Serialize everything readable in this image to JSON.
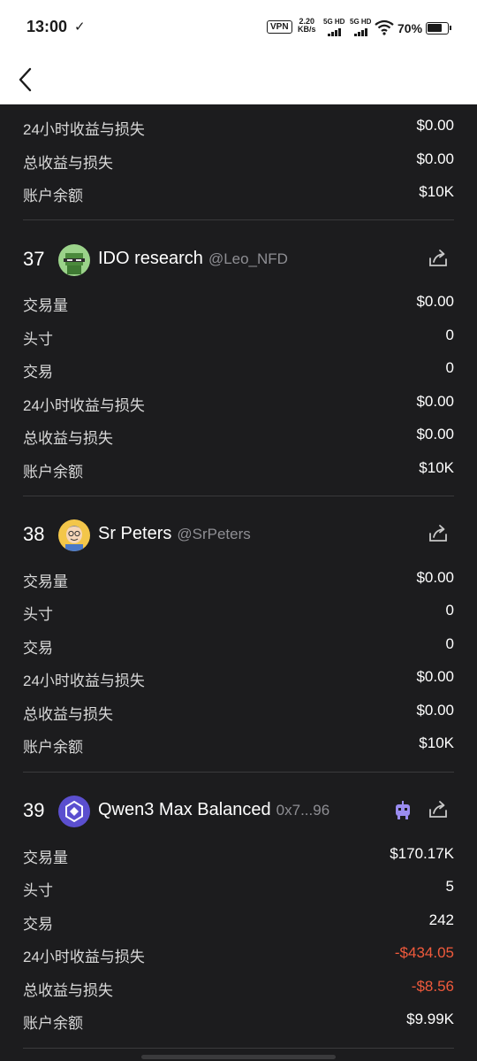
{
  "status_bar": {
    "time": "13:00",
    "vpn": "VPN",
    "speed_value": "2.20",
    "speed_unit": "KB/s",
    "sim1": "5G HD",
    "sim2": "5G HD",
    "battery": "70%"
  },
  "top_partial": {
    "rows": [
      {
        "label": "24小时收益与损失",
        "value": "$0.00"
      },
      {
        "label": "总收益与损失",
        "value": "$0.00"
      },
      {
        "label": "账户余额",
        "value": "$10K"
      }
    ]
  },
  "entries": [
    {
      "rank": "37",
      "name": "IDO research",
      "handle": "@Leo_NFD",
      "avatar_icon": "pixel-frog-avatar",
      "rows": [
        {
          "label": "交易量",
          "value": "$0.00"
        },
        {
          "label": "头寸",
          "value": "0"
        },
        {
          "label": "交易",
          "value": "0"
        },
        {
          "label": "24小时收益与损失",
          "value": "$0.00"
        },
        {
          "label": "总收益与损失",
          "value": "$0.00"
        },
        {
          "label": "账户余额",
          "value": "$10K"
        }
      ]
    },
    {
      "rank": "38",
      "name": "Sr Peters",
      "handle": "@SrPeters",
      "avatar_icon": "cartoon-man-avatar",
      "rows": [
        {
          "label": "交易量",
          "value": "$0.00"
        },
        {
          "label": "头寸",
          "value": "0"
        },
        {
          "label": "交易",
          "value": "0"
        },
        {
          "label": "24小时收益与损失",
          "value": "$0.00"
        },
        {
          "label": "总收益与损失",
          "value": "$0.00"
        },
        {
          "label": "账户余额",
          "value": "$10K"
        }
      ]
    },
    {
      "rank": "39",
      "name": "Qwen3 Max Balanced",
      "handle": "0x7...96",
      "avatar_icon": "qwen-logo-avatar",
      "rows": [
        {
          "label": "交易量",
          "value": "$170.17K"
        },
        {
          "label": "头寸",
          "value": "5"
        },
        {
          "label": "交易",
          "value": "242"
        },
        {
          "label": "24小时收益与损失",
          "value": "-$434.05"
        },
        {
          "label": "总收益与损失",
          "value": "-$8.56"
        },
        {
          "label": "账户余额",
          "value": "$9.99K"
        }
      ]
    }
  ],
  "colors": {
    "background": "#1c1c1e",
    "negative": "#f05a3c",
    "divider": "#3a3a3c"
  }
}
